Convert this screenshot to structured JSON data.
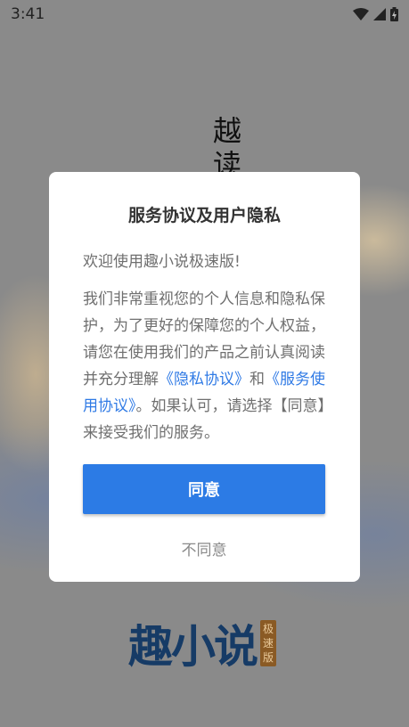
{
  "status_bar": {
    "time": "3:41"
  },
  "background": {
    "slogan_line1": "越",
    "slogan_line2": "读",
    "logo_text": "趣小说",
    "logo_badge": [
      "极",
      "速",
      "版"
    ]
  },
  "dialog": {
    "title": "服务协议及用户隐私",
    "welcome": "欢迎使用趣小说极速版!",
    "body_part1": "我们非常重视您的个人信息和隐私保护，为了更好的保障您的个人权益，请您在使用我们的产品之前认真阅读并充分理解",
    "privacy_link": "《隐私协议》",
    "and": "和",
    "service_link": "《服务使用协议》",
    "body_part2": "。如果认可，请选择【同意】来接受我们的服务。",
    "agree_label": "同意",
    "disagree_label": "不同意"
  },
  "colors": {
    "accent": "#2c7be5",
    "link": "#2f7ae5",
    "logo_brand": "#163b66"
  }
}
